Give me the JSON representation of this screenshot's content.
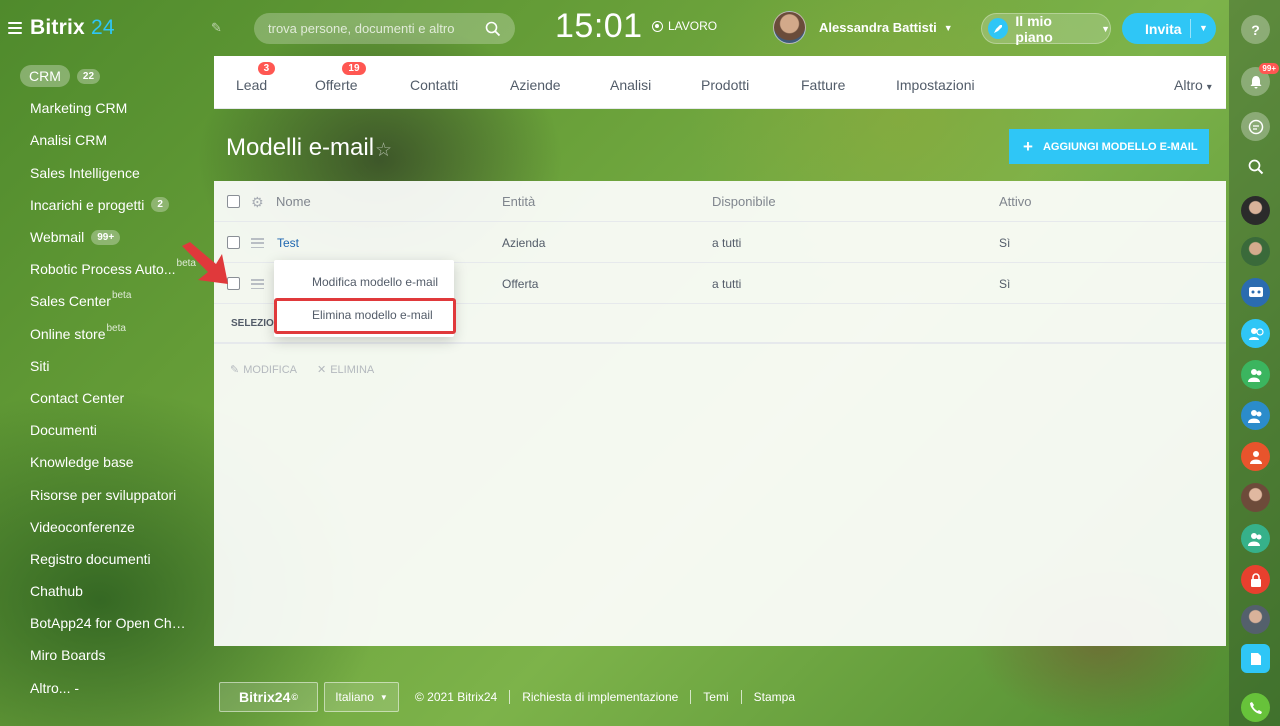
{
  "header": {
    "brand": "Bitrix",
    "brand_num": "24",
    "search_placeholder": "trova persone, documenti e altro",
    "clock": "15:01",
    "work_status": "LAVORO",
    "user_name": "Alessandra Battisti",
    "plan_label": "Il mio piano",
    "invite_label": "Invita"
  },
  "sidebar": {
    "items": [
      {
        "label": "CRM",
        "count": "22"
      },
      {
        "label": "Marketing CRM"
      },
      {
        "label": "Analisi CRM"
      },
      {
        "label": "Sales Intelligence"
      },
      {
        "label": "Incarichi e progetti",
        "count": "2"
      },
      {
        "label": "Webmail",
        "count": "99+"
      },
      {
        "label": "Robotic Process Auto...",
        "beta": "beta"
      },
      {
        "label": "Sales Center",
        "beta": "beta"
      },
      {
        "label": "Online store",
        "beta": "beta"
      },
      {
        "label": "Siti"
      },
      {
        "label": "Contact Center"
      },
      {
        "label": "Documenti"
      },
      {
        "label": "Knowledge base"
      },
      {
        "label": "Risorse per sviluppatori"
      },
      {
        "label": "Videoconferenze"
      },
      {
        "label": "Registro documenti"
      },
      {
        "label": "Chathub"
      },
      {
        "label": "BotApp24 for Open Cha..."
      },
      {
        "label": "Miro Boards"
      },
      {
        "label": "Altro... -"
      }
    ]
  },
  "tabs": [
    {
      "label": "Lead",
      "count": "3"
    },
    {
      "label": "Offerte",
      "count": "19"
    },
    {
      "label": "Contatti"
    },
    {
      "label": "Aziende"
    },
    {
      "label": "Analisi"
    },
    {
      "label": "Prodotti"
    },
    {
      "label": "Fatture"
    },
    {
      "label": "Impostazioni"
    },
    {
      "label": "Altro"
    }
  ],
  "page": {
    "title": "Modelli e-mail",
    "add_button": "AGGIUNGI MODELLO E-MAIL"
  },
  "grid": {
    "columns": [
      "Nome",
      "Entità",
      "Disponibile",
      "Attivo"
    ],
    "rows": [
      {
        "name": "Test",
        "entity": "Azienda",
        "available": "a tutti",
        "active": "Sì"
      },
      {
        "name": "",
        "entity": "Offerta",
        "available": "a tutti",
        "active": "Sì"
      }
    ],
    "selected_label": "SELEZIO",
    "edit_action": "MODIFICA",
    "delete_action": "ELIMINA"
  },
  "context_menu": {
    "edit": "Modifica modello e-mail",
    "delete": "Elimina modello e-mail"
  },
  "footer": {
    "b24": "Bitrix24",
    "language": "Italiano",
    "copyright": "© 2021 Bitrix24",
    "implementation": "Richiesta di implementazione",
    "themes": "Temi",
    "print": "Stampa"
  },
  "right_bar": {
    "notification_count": "99+"
  },
  "colors": {
    "accent": "#2fc6f6",
    "badge": "#ff5752",
    "highlight": "#e0393b"
  }
}
